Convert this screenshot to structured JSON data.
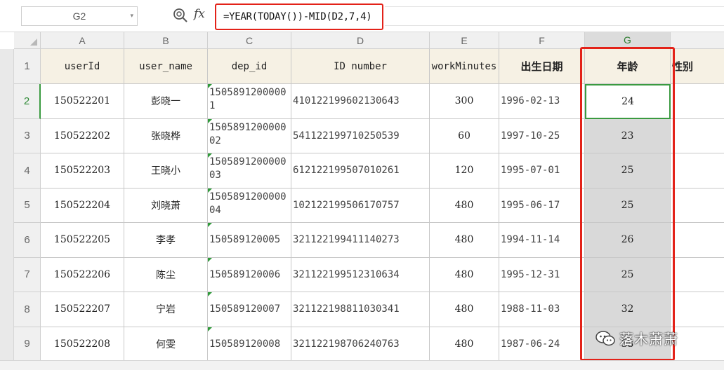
{
  "formula_bar": {
    "cell_ref": "G2",
    "fx_label": "fx",
    "formula": "=YEAR(TODAY())-MID(D2,7,4)"
  },
  "columns": [
    "A",
    "B",
    "C",
    "D",
    "E",
    "F",
    "G"
  ],
  "header_row": {
    "row_number": "1",
    "labels": [
      "userId",
      "user_name",
      "dep_id",
      "ID number",
      "workMinutes",
      "出生日期",
      "年龄",
      "性别"
    ]
  },
  "rows": [
    {
      "row_number": "2",
      "userId": "150522201",
      "user_name": "彭晓一",
      "dep_id": "15058912000001",
      "id_number": "410122199602130643",
      "workMinutes": "300",
      "birth_date": "1996-02-13",
      "age": "24"
    },
    {
      "row_number": "3",
      "userId": "150522202",
      "user_name": "张晓桦",
      "dep_id": "150589120000002",
      "id_number": "541122199710250539",
      "workMinutes": "60",
      "birth_date": "1997-10-25",
      "age": "23"
    },
    {
      "row_number": "4",
      "userId": "150522203",
      "user_name": "王晓小",
      "dep_id": "150589120000003",
      "id_number": "612122199507010261",
      "workMinutes": "120",
      "birth_date": "1995-07-01",
      "age": "25"
    },
    {
      "row_number": "5",
      "userId": "150522204",
      "user_name": "刘晓萧",
      "dep_id": "150589120000004",
      "id_number": "102122199506170757",
      "workMinutes": "480",
      "birth_date": "1995-06-17",
      "age": "25"
    },
    {
      "row_number": "6",
      "userId": "150522205",
      "user_name": "李孝",
      "dep_id": "150589120005",
      "id_number": "321122199411140273",
      "workMinutes": "480",
      "birth_date": "1994-11-14",
      "age": "26"
    },
    {
      "row_number": "7",
      "userId": "150522206",
      "user_name": "陈尘",
      "dep_id": "150589120006",
      "id_number": "321122199512310634",
      "workMinutes": "480",
      "birth_date": "1995-12-31",
      "age": "25"
    },
    {
      "row_number": "8",
      "userId": "150522207",
      "user_name": "宁岩",
      "dep_id": "150589120007",
      "id_number": "321122198811030341",
      "workMinutes": "480",
      "birth_date": "1988-11-03",
      "age": "32"
    },
    {
      "row_number": "9",
      "userId": "150522208",
      "user_name": "何雯",
      "dep_id": "150589120008",
      "id_number": "321122198706240763",
      "workMinutes": "480",
      "birth_date": "1987-06-24",
      "age": "33"
    }
  ],
  "watermark": "落木萧萧",
  "colors": {
    "highlight": "#e32219",
    "selection": "#3a9a40",
    "header_fill": "#f6f1e4",
    "age_fill": "#d9d9d9"
  }
}
